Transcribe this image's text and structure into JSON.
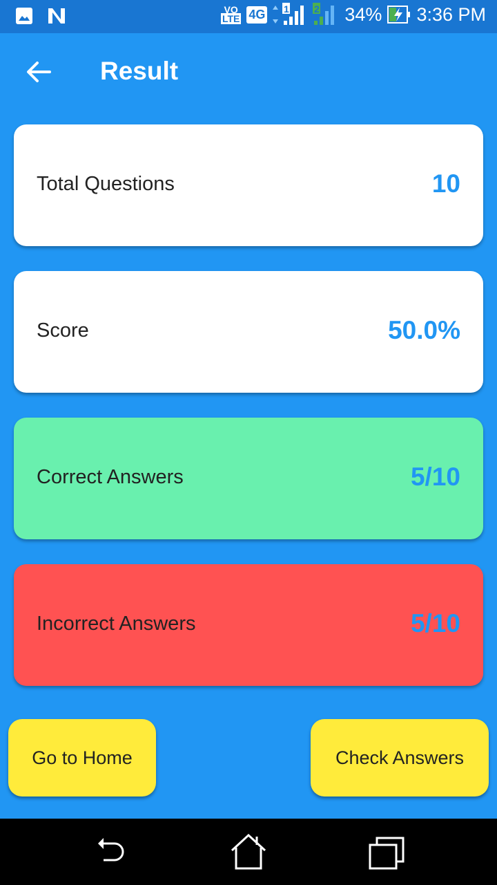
{
  "status_bar": {
    "icons_left": [
      "image-icon",
      "n-icon"
    ],
    "volte": "VO LTE",
    "network": "4G",
    "sim1": "1",
    "sim2": "2",
    "battery": "34%",
    "time": "3:36 PM"
  },
  "header": {
    "title": "Result",
    "back_icon": "arrow-left-icon"
  },
  "cards": [
    {
      "label": "Total Questions",
      "value": "10",
      "color": "#FFFFFF"
    },
    {
      "label": "Score",
      "value": "50.0%",
      "color": "#FFFFFF"
    },
    {
      "label": "Correct Answers",
      "value": "5/10",
      "color": "#69F0AE"
    },
    {
      "label": "Incorrect Answers",
      "value": "5/10",
      "color": "#FF5252"
    }
  ],
  "buttons": {
    "home": "Go to Home",
    "check": "Check Answers"
  },
  "colors": {
    "background": "#2196F3",
    "button": "#FFEB3B",
    "value_text": "#2196F3"
  }
}
